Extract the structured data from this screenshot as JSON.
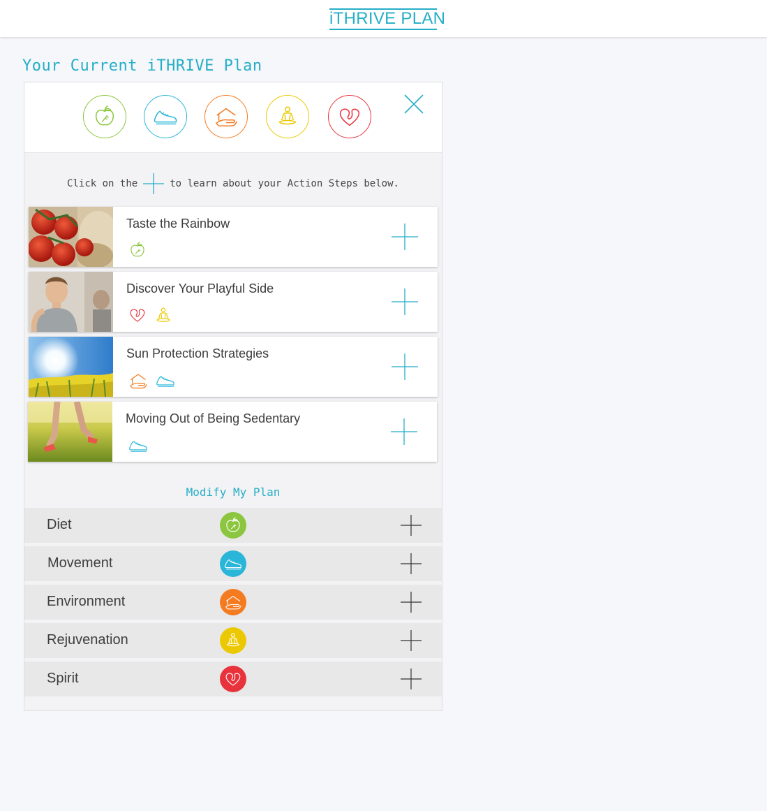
{
  "header": {
    "brand": "iTHRIVE PLAN",
    "brand_color": "#25aec8"
  },
  "page_title": "Your Current iTHRIVE Plan",
  "category_strip": {
    "icons": [
      {
        "name": "apple-icon",
        "color": "#8cc63f"
      },
      {
        "name": "shoe-icon",
        "color": "#29b6d8"
      },
      {
        "name": "house-hand-icon",
        "color": "#f47b20"
      },
      {
        "name": "meditation-icon",
        "color": "#ecc800"
      },
      {
        "name": "heart-icon",
        "color": "#e8323c"
      }
    ],
    "close_icon": "close-icon"
  },
  "instruction": {
    "before": "Click on the",
    "after": "to learn about your Action Steps below."
  },
  "action_steps": [
    {
      "title": "Taste the Rainbow",
      "icons": [
        "apple-icon"
      ],
      "image": "tomatoes"
    },
    {
      "title": "Discover Your Playful Side",
      "icons": [
        "heart-icon",
        "meditation-icon"
      ],
      "image": "yoga-woman"
    },
    {
      "title": "Sun Protection Strategies",
      "icons": [
        "house-hand-icon",
        "shoe-icon"
      ],
      "image": "sun-flowers"
    },
    {
      "title": "Moving Out of Being Sedentary",
      "icons": [
        "shoe-icon"
      ],
      "image": "running-legs"
    }
  ],
  "modify": {
    "label": "Modify My Plan",
    "rows": [
      {
        "label": "Diet",
        "icon": "apple-icon",
        "color": "#8cc63f"
      },
      {
        "label": "Movement",
        "icon": "shoe-icon",
        "color": "#29b6d8"
      },
      {
        "label": "Environment",
        "icon": "house-hand-icon",
        "color": "#f47b20"
      },
      {
        "label": "Rejuvenation",
        "icon": "meditation-icon",
        "color": "#ecc800"
      },
      {
        "label": "Spirit",
        "icon": "heart-icon",
        "color": "#e8323c"
      }
    ]
  }
}
